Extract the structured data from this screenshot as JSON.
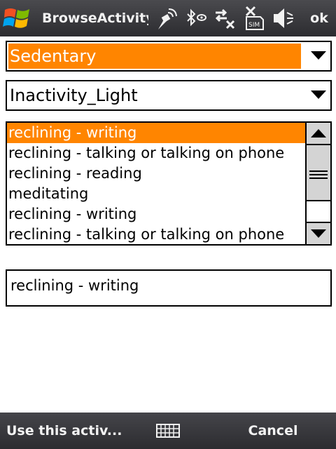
{
  "titlebar": {
    "title": "BrowseActivity",
    "ok_label": "ok",
    "icons": [
      "windows-start-icon",
      "antenna-signal-icon",
      "bluetooth-icon",
      "data-connection-icon",
      "no-sim-icon",
      "volume-off-icon"
    ]
  },
  "category_combo": {
    "value": "Sedentary"
  },
  "subcategory_combo": {
    "value": "Inactivity_Light"
  },
  "activity_list": {
    "items": [
      "reclining - writing",
      "reclining - talking or talking on phone",
      "reclining - reading",
      "meditating",
      "reclining - writing",
      "reclining - talking or talking on phone"
    ],
    "selected_index": 0
  },
  "detail": {
    "text": "reclining - writing"
  },
  "softkeys": {
    "left_label": "Use this activ...",
    "right_label": "Cancel",
    "center_icon": "keyboard-icon"
  },
  "colors": {
    "highlight": "#ff8500",
    "bar": "#38383c"
  }
}
